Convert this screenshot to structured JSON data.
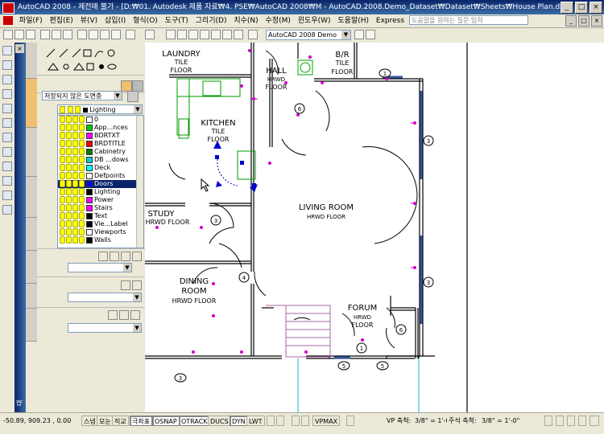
{
  "window": {
    "title": "AutoCAD 2008 - 제전매 불가 - [D:₩01. Autodesk 제품 자료₩4. PSE₩AutoCAD 2008₩M - AutoCAD.2008.Demo_Dataset₩Dataset₩Sheets₩House Plan.dwg]",
    "buttons": {
      "minimize": "_",
      "maximize": "□",
      "close": "×"
    }
  },
  "menubar": {
    "items": [
      "파일(F)",
      "편집(E)",
      "뷰(V)",
      "삽입(I)",
      "형식(O)",
      "도구(T)",
      "그리기(D)",
      "치수(N)",
      "수정(M)",
      "윈도우(W)",
      "도움말(H)",
      "Express"
    ],
    "help_placeholder": "도움말을 원하는 질문 입력",
    "doc_buttons": {
      "minimize": "_",
      "restore": "□",
      "close": "×"
    }
  },
  "toolbar": {
    "workspace": "AutoCAD 2008 Demo"
  },
  "palette": {
    "vertical_title": "대시보드",
    "layer_state": "저장되지 않은 도면층",
    "current_layer": "Lighting",
    "layers": [
      {
        "name": "0",
        "color": "#ffffff"
      },
      {
        "name": "App...nces",
        "color": "#00cc00"
      },
      {
        "name": "BDRTXT",
        "color": "#ff00ff"
      },
      {
        "name": "BRDTITLE",
        "color": "#ff0000"
      },
      {
        "name": "Cabinetry",
        "color": "#008000"
      },
      {
        "name": "DB ...dows",
        "color": "#00cccc"
      },
      {
        "name": "Deck",
        "color": "#00ffff"
      },
      {
        "name": "Defpoints",
        "color": "#ffffff"
      },
      {
        "name": "Doors",
        "color": "#0000ff"
      },
      {
        "name": "Lighting",
        "color": "#000000"
      },
      {
        "name": "Power",
        "color": "#ff00ff"
      },
      {
        "name": "Stairs",
        "color": "#ff00ff"
      },
      {
        "name": "Text",
        "color": "#000000"
      },
      {
        "name": "Vie...Label",
        "color": "#000000"
      },
      {
        "name": "Viewports",
        "color": "#ffffff"
      },
      {
        "name": "Walls",
        "color": "#000000"
      }
    ],
    "selected_layer_index": 8
  },
  "drawing": {
    "rooms": [
      {
        "name": "LAUNDRY",
        "floor": "TILE"
      },
      {
        "name": "FLOOR",
        "floor": ""
      },
      {
        "name": "B/R",
        "floor": "TILE"
      },
      {
        "name": "HALL",
        "floor": "HRWD"
      },
      {
        "name": "KITCHEN",
        "floor": "TILE"
      },
      {
        "name": "LIVING ROOM",
        "floor": "HRWD FLOOR"
      },
      {
        "name": "STUDY",
        "floor": "HRWD FLOOR"
      },
      {
        "name": "DINING",
        "floor": "ROOM"
      },
      {
        "name": "FORUM",
        "floor": "HRWD"
      }
    ],
    "labels": {
      "laundry_tile": "TILE",
      "laundry_floor": "FLOOR",
      "br_tile": "TILE",
      "br_floor": "FLOOR",
      "hall_hrwd": "HRWD",
      "hall_floor": "FLOOR",
      "kitchen_tile": "TILE",
      "kitchen_floor": "FLOOR",
      "living_floor": "HRWD FLOOR",
      "study_floor": "HRWD FLOOR",
      "dining_room": "ROOM",
      "dining_floor": "HRWD FLOOR",
      "forum_hrwd": "HRWD",
      "forum_floor": "FLOOR"
    },
    "tags": [
      "1",
      "3",
      "3",
      "3",
      "6",
      "3",
      "4",
      "3",
      "6",
      "1",
      "5",
      "5"
    ]
  },
  "statusbar": {
    "coords": "-50.89, 909.23 , 0.00",
    "toggles": [
      {
        "label": "스냅",
        "on": false
      },
      {
        "label": "모눈",
        "on": false
      },
      {
        "label": "직교",
        "on": false
      },
      {
        "label": "극좌표",
        "on": true
      },
      {
        "label": "OSNAP",
        "on": true
      },
      {
        "label": "OTRACK",
        "on": true
      },
      {
        "label": "DUCS",
        "on": false
      },
      {
        "label": "DYN",
        "on": true
      },
      {
        "label": "LWT",
        "on": false
      }
    ],
    "vpmax": "VPMAX",
    "vp_scale_label": "VP 축척:",
    "vp_scale": "3/8\" = 1'-0\"",
    "anno_scale_label": "주석 축척:",
    "anno_scale": "3/8\" = 1'-0\""
  }
}
